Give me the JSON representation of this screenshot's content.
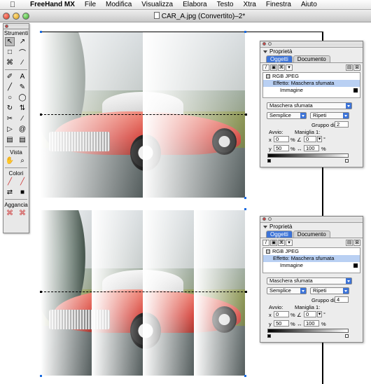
{
  "menubar": {
    "apple": "",
    "app_name": "FreeHand MX",
    "items": [
      "File",
      "Modifica",
      "Visualizza",
      "Elabora",
      "Testo",
      "Xtra",
      "Finestra",
      "Aiuto"
    ]
  },
  "window": {
    "title": "CAR_A.jpg (Convertito)–2*"
  },
  "tools": {
    "sections": {
      "strumenti": "Strumenti",
      "vista": "Vista",
      "colori": "Colori",
      "aggancia": "Aggancia"
    },
    "glyphs": {
      "pointer": "↖",
      "subselect": "↗",
      "lasso": "⌒",
      "page": "□",
      "crop": "⌘",
      "eyedropper": "∕",
      "pen": "✐",
      "text": "A",
      "line": "╱",
      "pencil": "✎",
      "ellipse": "○",
      "lasso2": "◯",
      "rotate": "↻",
      "scale": "⇅",
      "eraser": "✂",
      "knife": "∕",
      "arrow3": "▷",
      "spiral": "@",
      "blend": "▤",
      "hand": "✋",
      "zoom": "⌕",
      "stroke": "╱",
      "fill": "■",
      "swap": "⇄",
      "snap1": "⌘",
      "snap2": "⌘"
    }
  },
  "panels": [
    {
      "header": "Proprietà",
      "tabs": [
        "Oggetti",
        "Documento"
      ],
      "list": [
        "RGB JPEG",
        "Effetto: Maschera sfumata",
        "Immagine"
      ],
      "effect_select": "Maschera sfumata",
      "mode_select": "Semplice",
      "repeat_select": "Ripeti",
      "gruppo_label": "Gruppo di",
      "gruppo_value": "2",
      "avvio_label": "Avvio:",
      "maniglia_label": "Maniglia 1:",
      "x_label": "x",
      "x_value": "0",
      "y_label": "y",
      "y_value": "50",
      "pct": "%",
      "angle_value": "0",
      "deg": "°",
      "len_value": "100",
      "gradient_start": 0,
      "gradient_end": 1
    },
    {
      "header": "Proprietà",
      "tabs": [
        "Oggetti",
        "Documento"
      ],
      "list": [
        "RGB JPEG",
        "Effetto: Maschera sfumata",
        "Immagine"
      ],
      "effect_select": "Maschera sfumata",
      "mode_select": "Semplice",
      "repeat_select": "Ripeti",
      "gruppo_label": "Gruppo di",
      "gruppo_value": "4",
      "avvio_label": "Avvio:",
      "maniglia_label": "Maniglia 1:",
      "x_label": "x",
      "x_value": "0",
      "y_label": "y",
      "y_value": "50",
      "pct": "%",
      "angle_value": "0",
      "deg": "°",
      "len_value": "100",
      "gradient_start": 0,
      "gradient_end": 1
    }
  ],
  "colors": {
    "accent": "#3d74d8",
    "car_red": "#d44038",
    "list_highlight": "#b9d0f3"
  }
}
